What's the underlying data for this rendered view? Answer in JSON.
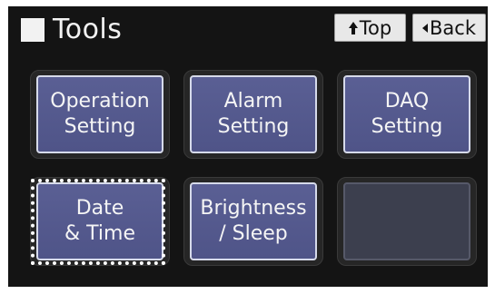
{
  "header": {
    "title": "Tools",
    "icon": "square-icon"
  },
  "nav": {
    "top_label": "Top",
    "top_icon": "up-arrow-icon",
    "back_label": "Back",
    "back_icon": "left-triangle-icon"
  },
  "tiles": [
    {
      "line1": "Operation",
      "line2": "Setting"
    },
    {
      "line1": "Alarm",
      "line2": "Setting"
    },
    {
      "line1": "DAQ",
      "line2": "Setting"
    },
    {
      "line1": "Date",
      "line2": "& Time",
      "focused": true
    },
    {
      "line1": "Brightness",
      "line2": "/ Sleep"
    },
    {
      "line1": "",
      "line2": "",
      "empty": true
    }
  ],
  "colors": {
    "background": "#141414",
    "tile_fill": "#555a8e",
    "tile_border": "#d6daea",
    "focus_ring": "#ffffff"
  }
}
